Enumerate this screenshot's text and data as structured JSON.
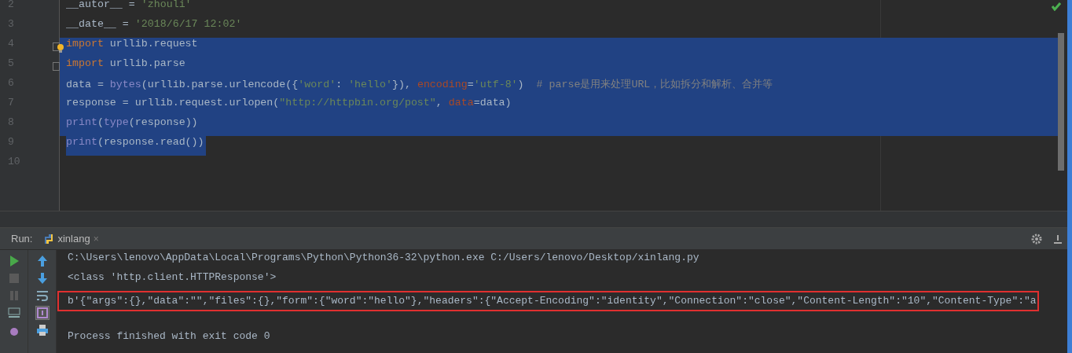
{
  "editor": {
    "lines": [
      {
        "number": "2",
        "selected": false,
        "tokens": [
          {
            "kind": "plain",
            "text": "__autor__ = "
          },
          {
            "kind": "string",
            "text": "'zhouli'"
          }
        ]
      },
      {
        "number": "3",
        "selected": false,
        "tokens": [
          {
            "kind": "plain",
            "text": "__date__ = "
          },
          {
            "kind": "string",
            "text": "'2018/6/17 12:02'"
          }
        ]
      },
      {
        "number": "4",
        "selected": true,
        "fold": true,
        "tokens": [
          {
            "kind": "keyword",
            "text": "import"
          },
          {
            "kind": "plain",
            "text": " urllib.request"
          }
        ]
      },
      {
        "number": "5",
        "selected": true,
        "fold": true,
        "tokens": [
          {
            "kind": "keyword",
            "text": "import"
          },
          {
            "kind": "plain",
            "text": " urllib.parse"
          }
        ]
      },
      {
        "number": "6",
        "selected": true,
        "tokens": [
          {
            "kind": "plain",
            "text": "data = "
          },
          {
            "kind": "builtin",
            "text": "bytes"
          },
          {
            "kind": "plain",
            "text": "(urllib.parse.urlencode({"
          },
          {
            "kind": "string",
            "text": "'word'"
          },
          {
            "kind": "plain",
            "text": ": "
          },
          {
            "kind": "string",
            "text": "'hello'"
          },
          {
            "kind": "plain",
            "text": "}), "
          },
          {
            "kind": "param",
            "text": "encoding"
          },
          {
            "kind": "plain",
            "text": "="
          },
          {
            "kind": "string",
            "text": "'utf-8'"
          },
          {
            "kind": "plain",
            "text": ")  "
          },
          {
            "kind": "comment",
            "text": "# parse是用来处理URL，比如拆分和解析、合并等"
          }
        ]
      },
      {
        "number": "7",
        "selected": true,
        "tokens": [
          {
            "kind": "plain",
            "text": "response = urllib.request.urlopen("
          },
          {
            "kind": "string",
            "text": "\"http://httpbin.org/post\""
          },
          {
            "kind": "plain",
            "text": ", "
          },
          {
            "kind": "param",
            "text": "data"
          },
          {
            "kind": "plain",
            "text": "=data)"
          }
        ]
      },
      {
        "number": "8",
        "selected": true,
        "tokens": [
          {
            "kind": "builtin",
            "text": "print"
          },
          {
            "kind": "plain",
            "text": "("
          },
          {
            "kind": "builtin",
            "text": "type"
          },
          {
            "kind": "plain",
            "text": "(response))"
          }
        ]
      },
      {
        "number": "9",
        "selected": true,
        "partial": true,
        "tokens": [
          {
            "kind": "builtin",
            "text": "print"
          },
          {
            "kind": "plain",
            "text": "(response.read())"
          }
        ]
      },
      {
        "number": "10",
        "selected": false
      }
    ]
  },
  "run_panel": {
    "label": "Run:",
    "tab": {
      "title": "xinlang",
      "close": "×"
    },
    "output": [
      {
        "kind": "command",
        "text": "C:\\Users\\lenovo\\AppData\\Local\\Programs\\Python\\Python36-32\\python.exe C:/Users/lenovo/Desktop/xinlang.py"
      },
      {
        "kind": "plain",
        "text": "<class 'http.client.HTTPResponse'>"
      },
      {
        "kind": "highlighted",
        "text": "b'{\"args\":{},\"data\":\"\",\"files\":{},\"form\":{\"word\":\"hello\"},\"headers\":{\"Accept-Encoding\":\"identity\",\"Connection\":\"close\",\"Content-Length\":\"10\",\"Content-Type\":\"a"
      },
      {
        "kind": "status",
        "text": "Process finished with exit code 0"
      }
    ]
  }
}
